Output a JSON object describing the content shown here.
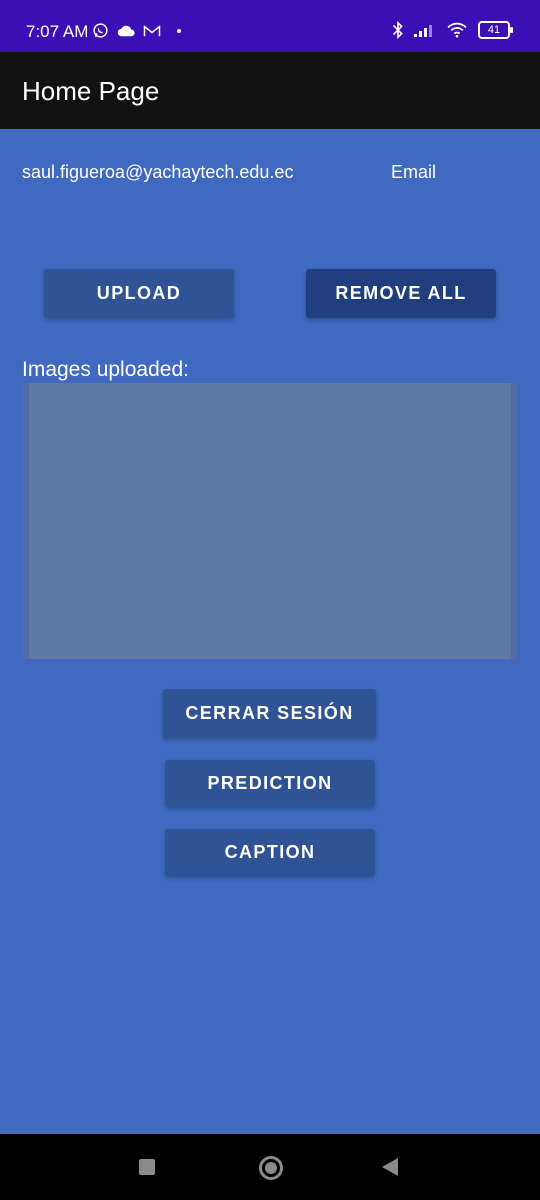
{
  "status_bar": {
    "time": "7:07 AM",
    "battery": "41",
    "icons_left": [
      "whatsapp-icon",
      "cloud-icon",
      "gmail-icon",
      "dot-icon"
    ],
    "icons_right": [
      "bluetooth-icon",
      "signal-icon",
      "wifi-icon",
      "battery-icon"
    ],
    "background": "#3a0fb5"
  },
  "app_bar": {
    "title": "Home Page",
    "background": "#121212"
  },
  "user": {
    "email": "saul.figueroa@yachaytech.edu.ec",
    "email_label": "Email"
  },
  "actions": {
    "upload_label": "UPLOAD",
    "remove_all_label": "REMOVE ALL"
  },
  "images": {
    "label": "Images uploaded:"
  },
  "bottom_actions": {
    "logout_label": "CERRAR SESIÓN",
    "prediction_label": "PREDICTION",
    "caption_label": "CAPTION"
  },
  "nav_bar": {
    "icons": [
      "recent-apps-icon",
      "home-icon",
      "back-icon"
    ]
  },
  "colors": {
    "page_background": "#3f6ac0",
    "button_primary": "#2f5395",
    "button_dark": "#213f7e",
    "list_background": "#5f77a3"
  }
}
